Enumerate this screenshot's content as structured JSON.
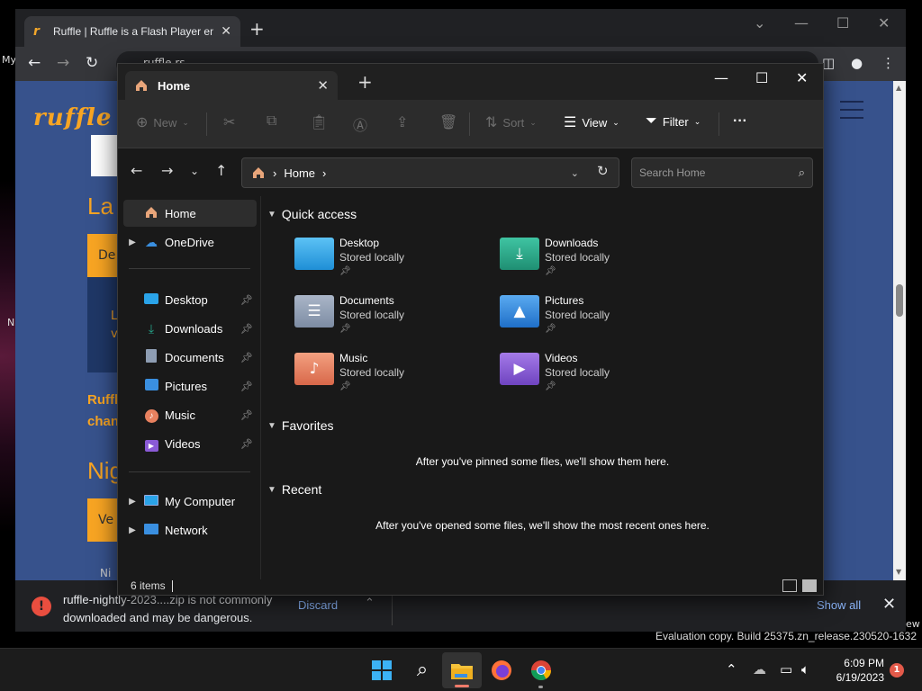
{
  "desktop": {
    "frag_my": "My",
    "frag_n": "N",
    "frag_ew": "ew",
    "watermark": "Evaluation copy. Build 25375.zn_release.230520-1632"
  },
  "browser": {
    "tab_title": "Ruffle | Ruffle is a Flash Player em",
    "tab_favicon": "r",
    "url": "ruffle.rs",
    "page": {
      "logo": "ruffle",
      "heading1": "La",
      "box1_text": "De",
      "link1a": "L",
      "link1b": "v",
      "para_line1": "Ruffl",
      "para_line2": "chan",
      "heading2": "Nig",
      "box2_text": "Ve",
      "bottom_text": "Ni"
    },
    "download_bar": {
      "warning_icon": "!",
      "message": "ruffle-nightly-2023....zip is not commonly downloaded and may be dangerous.",
      "discard": "Discard",
      "show_all": "Show all"
    }
  },
  "explorer": {
    "tab_title": "Home",
    "commands": {
      "new": "New",
      "sort": "Sort",
      "view": "View",
      "filter": "Filter",
      "more": "···"
    },
    "address": {
      "location": "Home",
      "separator": "›"
    },
    "search_placeholder": "Search Home",
    "nav_pane": {
      "home": "Home",
      "onedrive": "OneDrive",
      "pinned": [
        {
          "label": "Desktop",
          "icon": "desktop-icon"
        },
        {
          "label": "Downloads",
          "icon": "downloads-icon"
        },
        {
          "label": "Documents",
          "icon": "documents-icon"
        },
        {
          "label": "Pictures",
          "icon": "pictures-icon"
        },
        {
          "label": "Music",
          "icon": "music-icon"
        },
        {
          "label": "Videos",
          "icon": "videos-icon"
        }
      ],
      "my_computer": "My Computer",
      "network": "Network"
    },
    "quick_access": {
      "title": "Quick access",
      "items": [
        {
          "name": "Desktop",
          "status": "Stored locally",
          "color": "#2aa3e8"
        },
        {
          "name": "Downloads",
          "status": "Stored locally",
          "color": "#26a58a"
        },
        {
          "name": "Documents",
          "status": "Stored locally",
          "color": "#8e9db3"
        },
        {
          "name": "Pictures",
          "status": "Stored locally",
          "color": "#3a8fe0"
        },
        {
          "name": "Music",
          "status": "Stored locally",
          "color": "#e8815f"
        },
        {
          "name": "Videos",
          "status": "Stored locally",
          "color": "#8a5ad6"
        }
      ]
    },
    "favorites": {
      "title": "Favorites",
      "empty": "After you've pinned some files, we'll show them here."
    },
    "recent": {
      "title": "Recent",
      "empty": "After you've opened some files, we'll show the most recent ones here."
    },
    "status": {
      "items": "6 items"
    }
  },
  "taskbar": {
    "time": "6:09 PM",
    "date": "6/19/2023",
    "notifications": "1"
  },
  "colors": {
    "accent_orange": "#f8a523",
    "page_blue": "#37528c",
    "explorer_bg": "#191919",
    "link_blue": "#8ab4f8"
  }
}
